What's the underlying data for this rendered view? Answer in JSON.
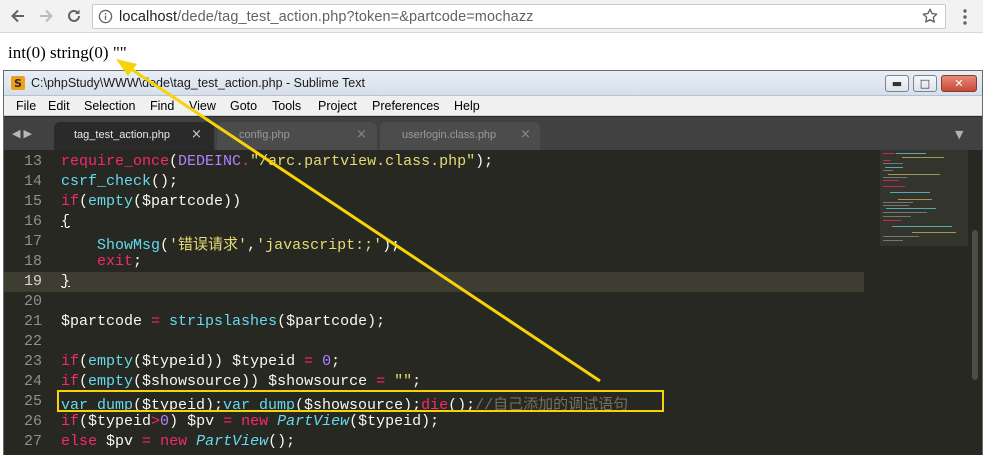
{
  "browser": {
    "url_host": "localhost",
    "url_path": "/dede/tag_test_action.php?token=&partcode=mochazz"
  },
  "page": {
    "output": "int(0) string(0) \"\""
  },
  "sublime": {
    "window_title": "C:\\phpStudy\\WWW\\dede\\tag_test_action.php - Sublime Text",
    "menu": [
      "File",
      "Edit",
      "Selection",
      "Find",
      "View",
      "Goto",
      "Tools",
      "Project",
      "Preferences",
      "Help"
    ],
    "tabs": [
      {
        "label": "tag_test_action.php",
        "active": true
      },
      {
        "label": "config.php",
        "active": false
      },
      {
        "label": "userlogin.class.php",
        "active": false
      }
    ],
    "current_line": "19",
    "lines": [
      {
        "n": "13",
        "tokens": [
          [
            "kw",
            "require_once"
          ],
          [
            "var",
            "("
          ],
          [
            "cst",
            "DEDEINC"
          ],
          [
            "kw",
            "."
          ],
          [
            "str",
            "\"/arc.partview.class.php\""
          ],
          [
            "var",
            ");"
          ]
        ]
      },
      {
        "n": "14",
        "tokens": [
          [
            "fn",
            "csrf_check"
          ],
          [
            "var",
            "();"
          ]
        ]
      },
      {
        "n": "15",
        "tokens": [
          [
            "kw",
            "if"
          ],
          [
            "var",
            "("
          ],
          [
            "fn",
            "empty"
          ],
          [
            "var",
            "($partcode))"
          ]
        ]
      },
      {
        "n": "16",
        "tokens": [
          [
            "brk",
            "{"
          ]
        ]
      },
      {
        "n": "17",
        "tokens": [
          [
            "var",
            "    "
          ],
          [
            "fn",
            "ShowMsg"
          ],
          [
            "var",
            "("
          ],
          [
            "str",
            "'错误请求'"
          ],
          [
            "var",
            ","
          ],
          [
            "str",
            "'javascript:;'"
          ],
          [
            "var",
            ");"
          ]
        ]
      },
      {
        "n": "18",
        "tokens": [
          [
            "var",
            "    "
          ],
          [
            "kw",
            "exit"
          ],
          [
            "var",
            ";"
          ]
        ]
      },
      {
        "n": "19",
        "tokens": [
          [
            "brk",
            "}"
          ]
        ]
      },
      {
        "n": "20",
        "tokens": []
      },
      {
        "n": "21",
        "tokens": [
          [
            "var",
            "$partcode "
          ],
          [
            "kw",
            "="
          ],
          [
            "var",
            " "
          ],
          [
            "fn",
            "stripslashes"
          ],
          [
            "var",
            "($partcode);"
          ]
        ]
      },
      {
        "n": "22",
        "tokens": []
      },
      {
        "n": "23",
        "tokens": [
          [
            "kw",
            "if"
          ],
          [
            "var",
            "("
          ],
          [
            "fn",
            "empty"
          ],
          [
            "var",
            "($typeid)) $typeid "
          ],
          [
            "kw",
            "="
          ],
          [
            "var",
            " "
          ],
          [
            "cst",
            "0"
          ],
          [
            "var",
            ";"
          ]
        ]
      },
      {
        "n": "24",
        "tokens": [
          [
            "kw",
            "if"
          ],
          [
            "var",
            "("
          ],
          [
            "fn",
            "empty"
          ],
          [
            "var",
            "($showsource)) $showsource "
          ],
          [
            "kw",
            "="
          ],
          [
            "var",
            " "
          ],
          [
            "str",
            "\"\""
          ],
          [
            "var",
            ";"
          ]
        ]
      },
      {
        "n": "25",
        "tokens": [
          [
            "fn",
            "var_dump"
          ],
          [
            "var",
            "($typeid);"
          ],
          [
            "fn",
            "var_dump"
          ],
          [
            "var",
            "($showsource);"
          ],
          [
            "kw",
            "die"
          ],
          [
            "var",
            "();"
          ],
          [
            "cmt",
            "//自己添加的调试语句"
          ]
        ]
      },
      {
        "n": "26",
        "tokens": [
          [
            "kw",
            "if"
          ],
          [
            "var",
            "($typeid"
          ],
          [
            "kw",
            ">"
          ],
          [
            "cst",
            "0"
          ],
          [
            "var",
            ") $pv "
          ],
          [
            "kw",
            "="
          ],
          [
            "var",
            " "
          ],
          [
            "kw",
            "new"
          ],
          [
            "var",
            " "
          ],
          [
            "cls",
            "PartView"
          ],
          [
            "var",
            "($typeid);"
          ]
        ]
      },
      {
        "n": "27",
        "tokens": [
          [
            "kw",
            "else"
          ],
          [
            "var",
            " $pv "
          ],
          [
            "kw",
            "="
          ],
          [
            "var",
            " "
          ],
          [
            "kw",
            "new"
          ],
          [
            "var",
            " "
          ],
          [
            "cls",
            "PartView"
          ],
          [
            "var",
            "();"
          ]
        ]
      }
    ]
  },
  "colors": {
    "annotation": "#f6d20a",
    "editor_bg": "#272822"
  }
}
